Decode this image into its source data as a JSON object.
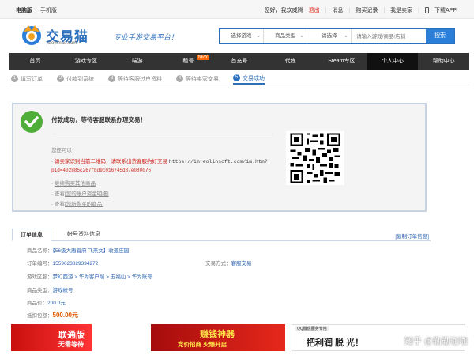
{
  "topbar": {
    "pc": "电脑版",
    "mobile": "手机版",
    "greeting": "您好，我欢威腾",
    "logout": "退出",
    "messages": "消息",
    "purchases": "购买记录",
    "seller": "我是卖家",
    "app": "下载APP"
  },
  "brand": {
    "name_cn": "交易猫",
    "name_en": "jiaoyimao.com",
    "slogan": "专业手游交易平台！"
  },
  "search": {
    "game": "选择游戏",
    "category": "商品类型",
    "choose": "请选择",
    "placeholder": "请输入游戏/商品/店铺",
    "button": "搜索"
  },
  "nav": [
    {
      "label": "首页"
    },
    {
      "label": "游戏专区"
    },
    {
      "label": "端游"
    },
    {
      "label": "租号",
      "badge": "NEW"
    },
    {
      "label": "首充号"
    },
    {
      "label": "代练"
    },
    {
      "label": "Steam专区"
    },
    {
      "label": "个人中心",
      "active": true
    },
    {
      "label": "帮助中心"
    }
  ],
  "steps": [
    {
      "num": "1",
      "label": "填写订单"
    },
    {
      "num": "2",
      "label": "付款到系统"
    },
    {
      "num": "3",
      "label": "等待客服过户资料"
    },
    {
      "num": "4",
      "label": "等待卖家交易"
    },
    {
      "num": "5",
      "label": "交易成功",
      "active": true
    }
  ],
  "success": {
    "title": "付款成功，等待客服联系办理交易！",
    "hint": "您还可以：",
    "tip": "· 请卖家识别当前二维码，请联系出货客服约好交易",
    "url": "https://im.eolinsoft.com/im.htm?",
    "pid": "pid=402885c267fbd9c016745d87e080076",
    "links": [
      {
        "prefix": "· ",
        "link": "继续购买其他商品"
      },
      {
        "prefix": "· 查看",
        "link": "[您的账户资金明细]"
      },
      {
        "prefix": "· 查看",
        "link": "[您所购买的商品]"
      }
    ]
  },
  "tabs": {
    "order": "订单信息",
    "account": "帐号资料信息",
    "print": "[复制订单信息]"
  },
  "order": {
    "name_label": "商品名称：",
    "name_value": "【56级大唐官府 飞燕女】收道庄园",
    "id_label": "订单编号：",
    "id_value": "1559023829394272",
    "method_label": "交易方式：",
    "method_value": "客服交易",
    "area_label": "游戏区服：",
    "area_value": "梦幻西游 > 华为客户端 > 五福山 > 华为账号",
    "type_label": "商品类型：",
    "type_value": "游戏帐号",
    "price_label": "商品价：",
    "price_value": "200.0元",
    "paid_label": "抵扣包额：",
    "paid_value": "500.00元"
  },
  "ads": {
    "ad1": "联通版",
    "ad1b": "无需等待",
    "ad2": "赚钱神器",
    "ad2b": "竞价招商 火爆开启",
    "ad3": "把利润 脱 光！",
    "ad3tag": "QQ微信服务专用"
  },
  "watermark": "知乎 @勒勒咖咖"
}
